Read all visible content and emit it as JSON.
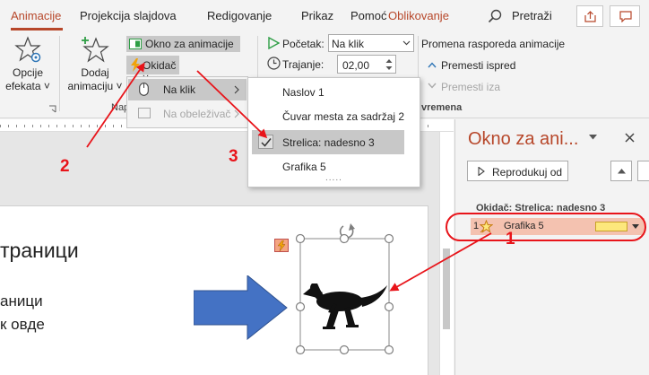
{
  "tabs": [
    "Animacije",
    "Projekcija slajdova",
    "Redigovanje",
    "Prikaz",
    "Pomoć",
    "Oblikovanje"
  ],
  "search": "Pretraži",
  "ribbon": {
    "opcije": "Opcije",
    "efekata": "efekata ˅",
    "dodaj": "Dodaj",
    "animaciju": "animaciju ˅",
    "okno_button": "Okno za animacije",
    "okidac": "Okidač ˅",
    "group_nap": "Nap",
    "pocetak_label": "Početak:",
    "pocetak_value": "Na klik",
    "trajanje_label": "Trajanje:",
    "trajanje_value": "02,00",
    "promena": "Promena rasporeda animacije",
    "premesti_ispred": "Premesti ispred",
    "premesti_iza": "Premesti iza",
    "vremena": "vremena"
  },
  "menu1": {
    "na_klik": "Na klik",
    "na_obelezivac": "Na obeleživač"
  },
  "menu2": {
    "items": [
      "Naslov 1",
      "Čuvar mesta za sadržaj 2",
      "Strelica: nadesno 3",
      "Grafika 5"
    ],
    "checked_index": 2,
    "more": "....."
  },
  "slide": {
    "text1": "траници",
    "text2": "аници",
    "text3": "к овде"
  },
  "pane": {
    "title": "Okno za ani...",
    "play": "Reprodukuj od",
    "trigger_label": "Okidač: Strelica: nadesno 3",
    "item_number": "1",
    "item_name": "Grafika 5"
  },
  "annotations": [
    "1",
    "2",
    "3"
  ],
  "colors": {
    "accent": "#b7472a",
    "annotation_red": "#e8141a",
    "item_bg": "#f4c2b0",
    "timeline_bar": "#fde77c",
    "arrow_blue": "#4472c4"
  }
}
